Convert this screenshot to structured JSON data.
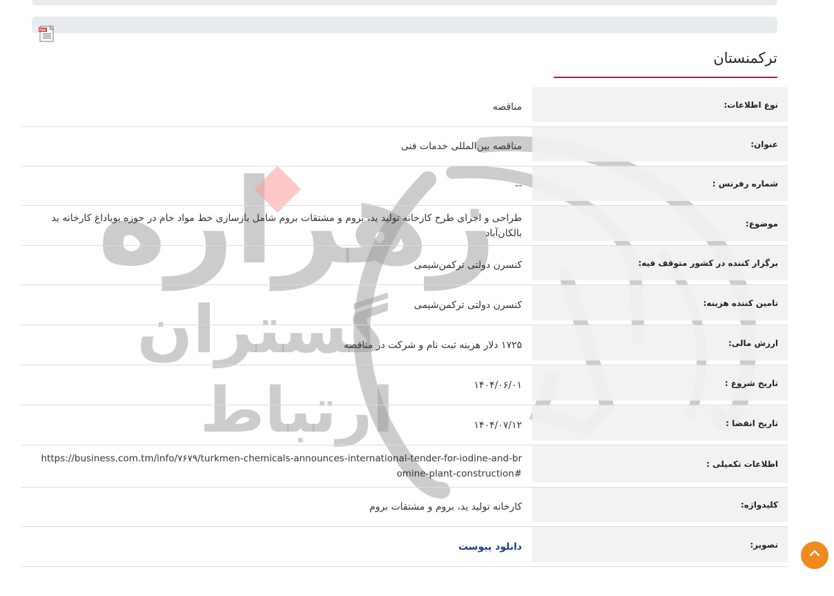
{
  "header": {
    "country": "ترکمنستان",
    "pdf_icon": "pdf-file-icon",
    "accent_color": "#9c1f4d"
  },
  "watermark": {
    "icon": "brand-logo-watermark",
    "text_main": "زهراره",
    "text_sub1": "گستران",
    "text_sub2": "ارتباط"
  },
  "rows": [
    {
      "label": "نوع اطلاعات:",
      "value": "مناقصه"
    },
    {
      "label": "عنوان:",
      "value": "مناقصه بین‌المللی خدمات فنی"
    },
    {
      "label": "شماره رفرنس :",
      "value": "--"
    },
    {
      "label": "موضوع:",
      "value": "طراحی و اجرای طرح کارخانه تولید ید، بروم و مشتقات بروم شامل بازسازی خط مواد خام در حوزه بویاداغ کارخانه ید بالکان‌آباد"
    },
    {
      "label": "برگزار کننده در کشور متوقف فیه:",
      "value": "کنسرن دولتی ترکمن‌شیمی"
    },
    {
      "label": "تامین کننده هزینه:",
      "value": "کنسرن دولتی ترکمن‌شیمی"
    },
    {
      "label": "ارزش مالی:",
      "value": "۱۷۲۵ دلار هزینه ثبت نام و شرکت در مناقصه"
    },
    {
      "label": "تاریخ شروع :",
      "value": "۱۴۰۴/۰۶/۰۱"
    },
    {
      "label": "تاریخ انقضا :",
      "value": "۱۴۰۴/۰۷/۱۲"
    },
    {
      "label": "اطلاعات تکمیلی :",
      "value": "https://business.com.tm/info/۷۶۷۹/turkmen-chemicals-announces-international-tender-for-iodine-and-bromine-plant-construction#"
    },
    {
      "label": "کلیدواژه:",
      "value": "کارخانه تولید ید، بروم و مشتقات بروم"
    },
    {
      "label": "تصویر:",
      "value": "دانلود پیوست"
    }
  ],
  "scroll_top": {
    "icon": "chevron-up-icon",
    "color": "#f08a1c"
  }
}
